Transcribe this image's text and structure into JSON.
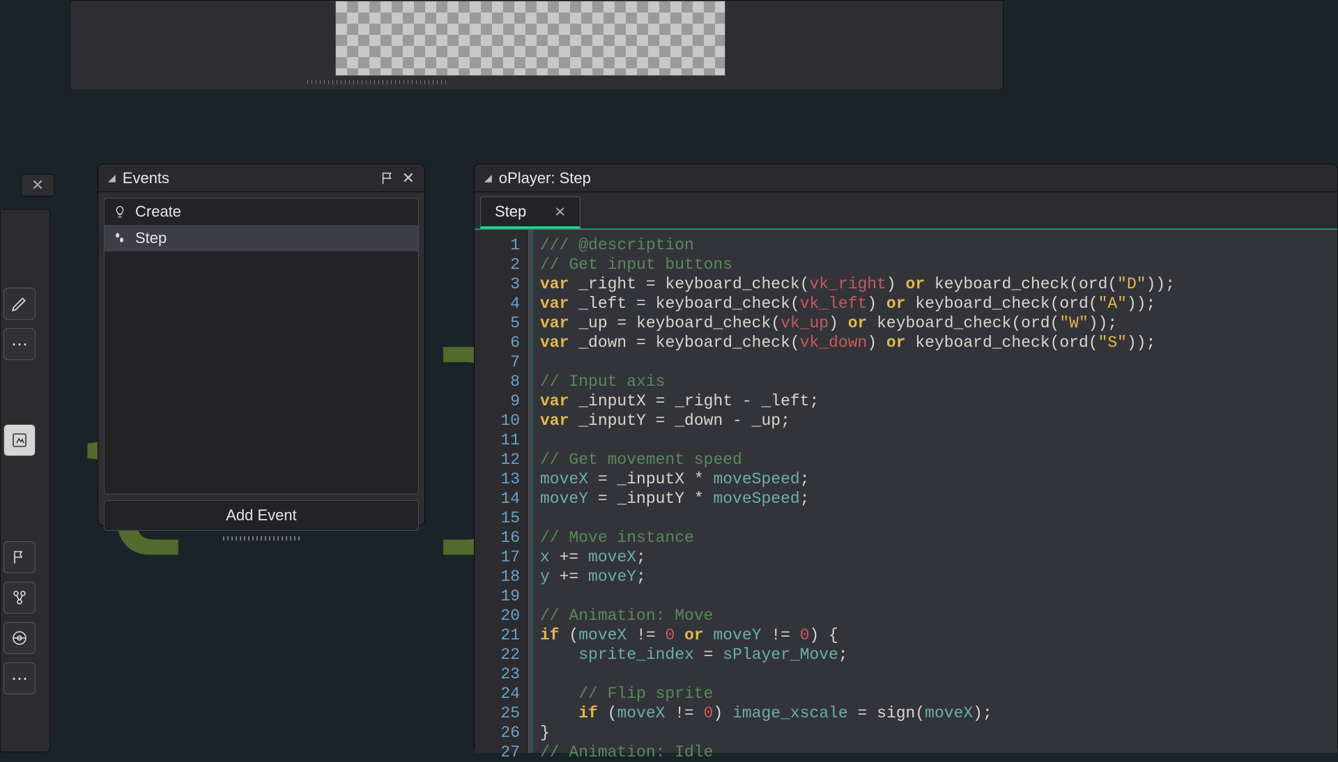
{
  "eventsPanel": {
    "title": "Events",
    "addEventLabel": "Add Event",
    "items": [
      {
        "icon": "bulb",
        "label": "Create",
        "selected": false
      },
      {
        "icon": "step",
        "label": "Step",
        "selected": true
      }
    ]
  },
  "codePanel": {
    "title": "oPlayer: Step",
    "tab": {
      "label": "Step"
    },
    "lineStart": 1,
    "lines": [
      "/// @description",
      "// Get input buttons",
      "var _right = keyboard_check(vk_right) or keyboard_check(ord(\"D\"));",
      "var _left = keyboard_check(vk_left) or keyboard_check(ord(\"A\"));",
      "var _up = keyboard_check(vk_up) or keyboard_check(ord(\"W\"));",
      "var _down = keyboard_check(vk_down) or keyboard_check(ord(\"S\"));",
      "",
      "// Input axis",
      "var _inputX = _right - _left;",
      "var _inputY = _down - _up;",
      "",
      "// Get movement speed",
      "moveX = _inputX * moveSpeed;",
      "moveY = _inputY * moveSpeed;",
      "",
      "// Move instance",
      "x += moveX;",
      "y += moveY;",
      "",
      "// Animation: Move",
      "if (moveX != 0 or moveY != 0) {",
      "    sprite_index = sPlayer_Move;",
      "",
      "    // Flip sprite",
      "    if (moveX != 0) image_xscale = sign(moveX);",
      "}",
      "// Animation: Idle"
    ]
  }
}
